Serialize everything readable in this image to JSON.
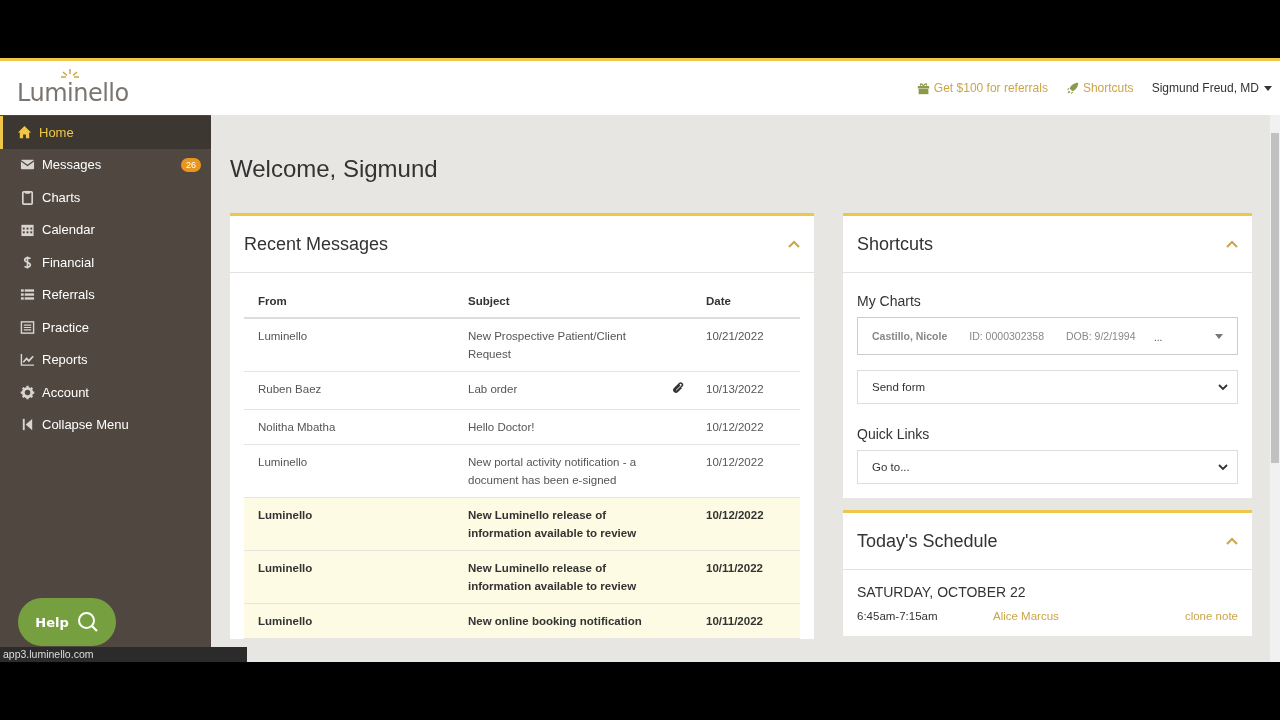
{
  "header": {
    "logo": "Luminello",
    "links": [
      {
        "label": "Get $100 for referrals"
      },
      {
        "label": "Shortcuts"
      }
    ],
    "user": "Sigmund Freud, MD"
  },
  "sidebar": {
    "items": [
      {
        "label": "Home",
        "selected": true
      },
      {
        "label": "Messages",
        "selected": false,
        "badge": "26"
      },
      {
        "label": "Charts",
        "selected": false
      },
      {
        "label": "Calendar",
        "selected": false
      },
      {
        "label": "Financial",
        "selected": false
      },
      {
        "label": "Referrals",
        "selected": false
      },
      {
        "label": "Practice",
        "selected": false
      },
      {
        "label": "Reports",
        "selected": false
      },
      {
        "label": "Account",
        "selected": false
      },
      {
        "label": "Collapse Menu",
        "selected": false
      }
    ],
    "help": "Help"
  },
  "welcome": "Welcome, Sigmund",
  "recent_messages": {
    "title": "Recent Messages",
    "columns": [
      "From",
      "Subject",
      "Date"
    ],
    "rows": [
      {
        "from": "Luminello",
        "subject": "New Prospective Patient/Client Request",
        "date": "10/21/2022",
        "attachment": false,
        "unread": false
      },
      {
        "from": "Ruben Baez",
        "subject": "Lab order",
        "date": "10/13/2022",
        "attachment": true,
        "unread": false
      },
      {
        "from": "Nolitha Mbatha",
        "subject": "Hello Doctor!",
        "date": "10/12/2022",
        "attachment": false,
        "unread": false
      },
      {
        "from": "Luminello",
        "subject": "New portal activity notification - a document has been e-signed",
        "date": "10/12/2022",
        "attachment": false,
        "unread": false
      },
      {
        "from": "Luminello",
        "subject": "New Luminello release of information available to review",
        "date": "10/12/2022",
        "attachment": false,
        "unread": true
      },
      {
        "from": "Luminello",
        "subject": "New Luminello release of information available to review",
        "date": "10/11/2022",
        "attachment": false,
        "unread": true
      },
      {
        "from": "Luminello",
        "subject": "New online booking notification",
        "date": "10/11/2022",
        "attachment": false,
        "unread": true
      }
    ]
  },
  "shortcuts": {
    "title": "Shortcuts",
    "my_charts": {
      "label": "My Charts",
      "patient": "Castillo, Nicole",
      "id": "ID: 0000302358",
      "dob": "DOB: 9/2/1994",
      "more": "...",
      "form_select": "Send form"
    },
    "quick_links": {
      "label": "Quick Links",
      "select": "Go to..."
    }
  },
  "schedule": {
    "title": "Today's Schedule",
    "day": "SATURDAY, OCTOBER 22",
    "entries": [
      {
        "time": "6:45am-7:15am",
        "name": "Alice Marcus",
        "action": "clone note"
      }
    ]
  },
  "status_bar": "app3.luminello.com"
}
